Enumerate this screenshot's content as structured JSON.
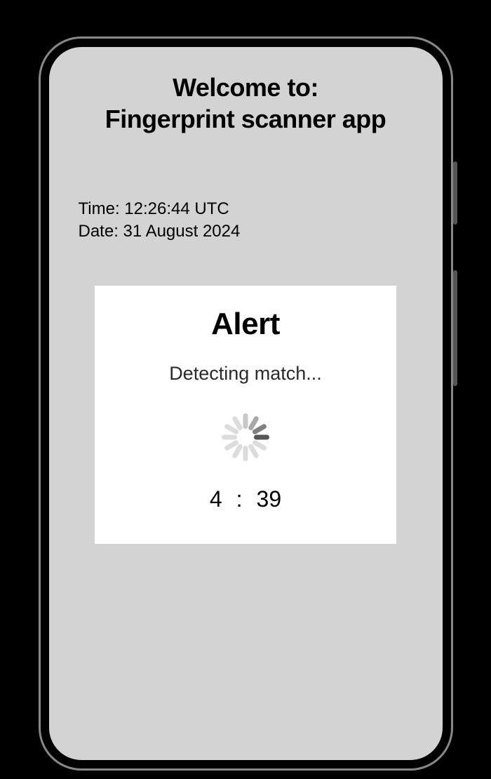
{
  "header": {
    "title_line1": "Welcome to:",
    "title_line2": "Fingerprint scanner app"
  },
  "datetime": {
    "time_label": "Time: ",
    "time_value": "12:26:44 UTC",
    "date_label": "Date: ",
    "date_value": "31 August 2024"
  },
  "alert": {
    "title": "Alert",
    "subtitle": "Detecting match...",
    "countdown_minutes": "4",
    "countdown_separator": ":",
    "countdown_seconds": "39"
  },
  "colors": {
    "phone_screen_bg": "#d3d3d3",
    "alert_card_bg": "#ffffff",
    "spinner_active": "#555555",
    "spinner_inactive": "#dcdcdc"
  }
}
